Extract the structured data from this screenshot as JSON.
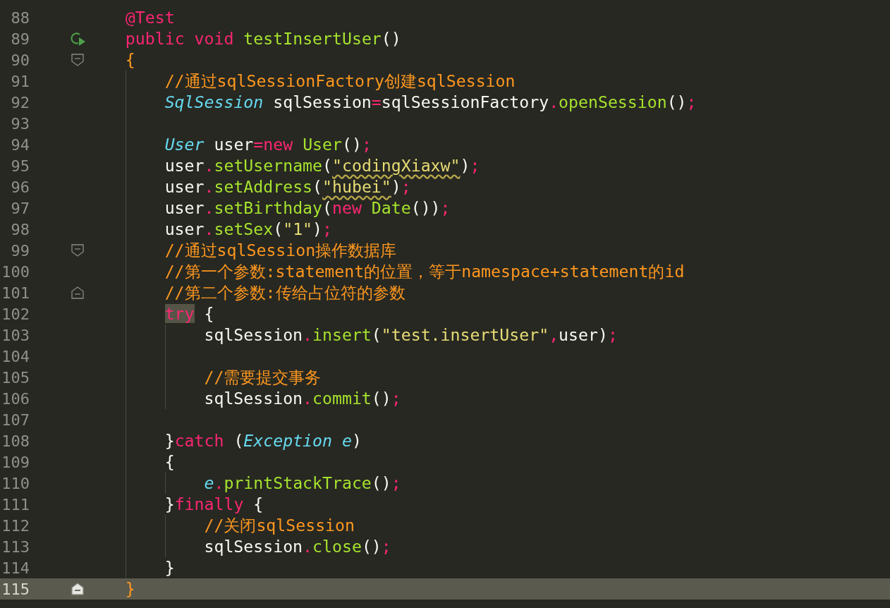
{
  "editor": {
    "lines": [
      {
        "number": "88",
        "current": false,
        "tokens": [
          {
            "kind": "annot",
            "text": "    @Test"
          }
        ]
      },
      {
        "number": "89",
        "current": false,
        "gutter_marker": {
          "kind": "run"
        },
        "tokens": [
          {
            "kind": "kw",
            "text": "    public"
          },
          {
            "kind": "kw",
            "text": " void"
          },
          {
            "kind": "fn",
            "text": " testInsertUser"
          },
          {
            "kind": "plain",
            "text": "()"
          }
        ]
      },
      {
        "number": "90",
        "current": false,
        "gutter_marker": {
          "kind": "fold-start"
        },
        "tokens": [
          {
            "kind": "brace",
            "text": "    {"
          }
        ]
      },
      {
        "number": "91",
        "current": false,
        "tokens": [
          {
            "kind": "comment",
            "text": "        //通过sqlSessionFactory创建sqlSession"
          }
        ]
      },
      {
        "number": "92",
        "current": false,
        "tokens": [
          {
            "kind": "type",
            "text": "        SqlSession"
          },
          {
            "kind": "plain",
            "text": " sqlSession"
          },
          {
            "kind": "op",
            "text": "="
          },
          {
            "kind": "plain",
            "text": "sqlSessionFactory"
          },
          {
            "kind": "op",
            "text": "."
          },
          {
            "kind": "fn",
            "text": "openSession"
          },
          {
            "kind": "plain",
            "text": "()"
          },
          {
            "kind": "op",
            "text": ";"
          }
        ]
      },
      {
        "number": "93",
        "current": false
      },
      {
        "number": "94",
        "current": false,
        "tokens": [
          {
            "kind": "type",
            "text": "        User"
          },
          {
            "kind": "plain",
            "text": " user"
          },
          {
            "kind": "op",
            "text": "="
          },
          {
            "kind": "kw",
            "text": "new"
          },
          {
            "kind": "fn",
            "text": " User"
          },
          {
            "kind": "plain",
            "text": "()"
          },
          {
            "kind": "op",
            "text": ";"
          }
        ]
      },
      {
        "number": "95",
        "current": false,
        "tokens": [
          {
            "kind": "plain",
            "text": "        user"
          },
          {
            "kind": "op",
            "text": "."
          },
          {
            "kind": "fn",
            "text": "setUsername"
          },
          {
            "kind": "plain",
            "text": "("
          },
          {
            "kind": "typo",
            "text": "\"codingXiaxw\""
          },
          {
            "kind": "plain",
            "text": ")"
          },
          {
            "kind": "op",
            "text": ";"
          }
        ]
      },
      {
        "number": "96",
        "current": false,
        "tokens": [
          {
            "kind": "plain",
            "text": "        user"
          },
          {
            "kind": "op",
            "text": "."
          },
          {
            "kind": "fn",
            "text": "setAddress"
          },
          {
            "kind": "plain",
            "text": "("
          },
          {
            "kind": "typo",
            "text": "\"hubei\""
          },
          {
            "kind": "plain",
            "text": ")"
          },
          {
            "kind": "op",
            "text": ";"
          }
        ]
      },
      {
        "number": "97",
        "current": false,
        "tokens": [
          {
            "kind": "plain",
            "text": "        user"
          },
          {
            "kind": "op",
            "text": "."
          },
          {
            "kind": "fn",
            "text": "setBirthday"
          },
          {
            "kind": "plain",
            "text": "("
          },
          {
            "kind": "kw",
            "text": "new"
          },
          {
            "kind": "fn",
            "text": " Date"
          },
          {
            "kind": "plain",
            "text": "())"
          },
          {
            "kind": "op",
            "text": ";"
          }
        ]
      },
      {
        "number": "98",
        "current": false,
        "tokens": [
          {
            "kind": "plain",
            "text": "        user"
          },
          {
            "kind": "op",
            "text": "."
          },
          {
            "kind": "fn",
            "text": "setSex"
          },
          {
            "kind": "plain",
            "text": "("
          },
          {
            "kind": "str",
            "text": "\"1\""
          },
          {
            "kind": "plain",
            "text": ")"
          },
          {
            "kind": "op",
            "text": ";"
          }
        ]
      },
      {
        "number": "99",
        "current": false,
        "gutter_marker": {
          "kind": "fold-start"
        },
        "tokens": [
          {
            "kind": "comment",
            "text": "        //通过sqlSession操作数据库"
          }
        ]
      },
      {
        "number": "100",
        "current": false,
        "tokens": [
          {
            "kind": "comment",
            "text": "        //第一个参数:statement的位置，等于namespace+statement的id"
          }
        ]
      },
      {
        "number": "101",
        "current": false,
        "gutter_marker": {
          "kind": "fold-end"
        },
        "tokens": [
          {
            "kind": "comment",
            "text": "        //第二个参数:传给占位符的参数"
          }
        ]
      },
      {
        "number": "102",
        "current": false,
        "tokens": [
          {
            "kind": "match",
            "text": "        try"
          },
          {
            "kind": "plain",
            "text": " {"
          }
        ]
      },
      {
        "number": "103",
        "current": false,
        "tokens": [
          {
            "kind": "plain",
            "text": "            sqlSession"
          },
          {
            "kind": "op",
            "text": "."
          },
          {
            "kind": "fn",
            "text": "insert"
          },
          {
            "kind": "plain",
            "text": "("
          },
          {
            "kind": "str",
            "text": "\"test.insertUser\""
          },
          {
            "kind": "op",
            "text": ","
          },
          {
            "kind": "plain",
            "text": "user)"
          },
          {
            "kind": "op",
            "text": ";"
          }
        ]
      },
      {
        "number": "104",
        "current": false
      },
      {
        "number": "105",
        "current": false,
        "tokens": [
          {
            "kind": "comment",
            "text": "            //需要提交事务"
          }
        ]
      },
      {
        "number": "106",
        "current": false,
        "tokens": [
          {
            "kind": "plain",
            "text": "            sqlSession"
          },
          {
            "kind": "op",
            "text": "."
          },
          {
            "kind": "fn",
            "text": "commit"
          },
          {
            "kind": "plain",
            "text": "()"
          },
          {
            "kind": "op",
            "text": ";"
          }
        ]
      },
      {
        "number": "107",
        "current": false
      },
      {
        "number": "108",
        "current": false,
        "tokens": [
          {
            "kind": "plain",
            "text": "        }"
          },
          {
            "kind": "kw",
            "text": "catch"
          },
          {
            "kind": "plain",
            "text": " ("
          },
          {
            "kind": "type",
            "text": "Exception"
          },
          {
            "kind": "param",
            "text": " e"
          },
          {
            "kind": "plain",
            "text": ")"
          }
        ]
      },
      {
        "number": "109",
        "current": false,
        "tokens": [
          {
            "kind": "plain",
            "text": "        {"
          }
        ]
      },
      {
        "number": "110",
        "current": false,
        "tokens": [
          {
            "kind": "param",
            "text": "            e"
          },
          {
            "kind": "op",
            "text": "."
          },
          {
            "kind": "fn",
            "text": "printStackTrace"
          },
          {
            "kind": "plain",
            "text": "()"
          },
          {
            "kind": "op",
            "text": ";"
          }
        ]
      },
      {
        "number": "111",
        "current": false,
        "tokens": [
          {
            "kind": "plain",
            "text": "        }"
          },
          {
            "kind": "kw",
            "text": "finally"
          },
          {
            "kind": "plain",
            "text": " {"
          }
        ]
      },
      {
        "number": "112",
        "current": false,
        "tokens": [
          {
            "kind": "comment",
            "text": "            //关闭sqlSession"
          }
        ]
      },
      {
        "number": "113",
        "current": false,
        "tokens": [
          {
            "kind": "plain",
            "text": "            sqlSession"
          },
          {
            "kind": "op",
            "text": "."
          },
          {
            "kind": "fn",
            "text": "close"
          },
          {
            "kind": "plain",
            "text": "()"
          },
          {
            "kind": "op",
            "text": ";"
          }
        ]
      },
      {
        "number": "114",
        "current": false,
        "tokens": [
          {
            "kind": "plain",
            "text": "        }"
          }
        ]
      },
      {
        "number": "115",
        "current": true,
        "gutter_marker": {
          "kind": "fold-end"
        },
        "tokens": [
          {
            "kind": "brace",
            "text": "    }"
          }
        ]
      }
    ]
  }
}
